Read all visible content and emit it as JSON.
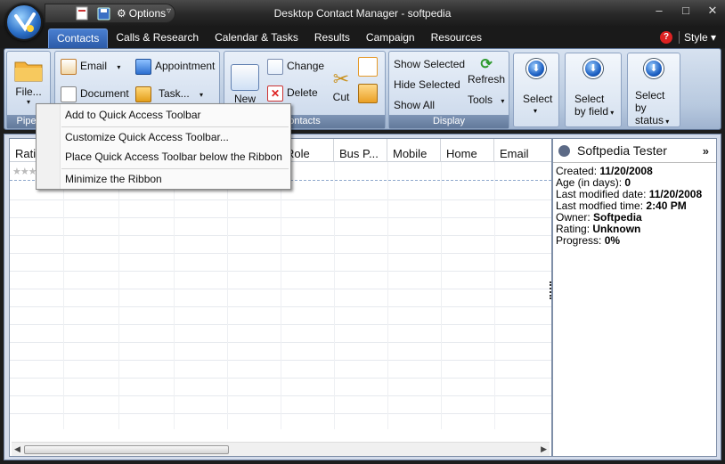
{
  "window": {
    "title": "Desktop Contact Manager - softpedia",
    "controls": {
      "minimize": "–",
      "maximize": "□",
      "close": "✕"
    }
  },
  "quick_access": {
    "options_label": "Options",
    "more_label": "▿"
  },
  "tabs": [
    {
      "label": "Contacts",
      "active": true
    },
    {
      "label": "Calls & Research"
    },
    {
      "label": "Calendar & Tasks"
    },
    {
      "label": "Results"
    },
    {
      "label": "Campaign"
    },
    {
      "label": "Resources"
    }
  ],
  "help_label": "?",
  "style_menu": "Style ▾",
  "ribbon": {
    "file_label": "File...",
    "pipeline_label": "Pipeli",
    "email_label": "Email",
    "appointment_label": "Appointment",
    "document_label": "Document",
    "task_label": "Task...",
    "new_label": "New",
    "change_label": "Change",
    "delete_label": "Delete",
    "cut_label": "Cut",
    "contacts_group": "ontacts",
    "show_selected": "Show Selected",
    "hide_selected": "Hide Selected",
    "show_all": "Show All",
    "refresh_label": "Refresh",
    "tools_label": "Tools",
    "display_group": "Display",
    "select_label": "Select",
    "select_by_field_1": "Select",
    "select_by_field_2": "by field",
    "select_by_status_1": "Select",
    "select_by_status_2": "by",
    "select_by_status_3": "status"
  },
  "context_menu": {
    "items": [
      {
        "label": "Add to Quick Access Toolbar"
      },
      {
        "label": "Customize Quick Access Toolbar..."
      },
      {
        "label": "Place Quick Access Toolbar below the Ribbon"
      },
      {
        "label": "Minimize the Ribbon"
      }
    ]
  },
  "grid": {
    "columns": [
      "Rati",
      "",
      "",
      "",
      "",
      "Role",
      "Bus P...",
      "Mobile",
      "Home",
      "Email"
    ],
    "first_row_rating": "★★★"
  },
  "detail": {
    "name": "Softpedia Tester",
    "expand": "»",
    "fields": [
      {
        "label": "Created:",
        "value": "11/20/2008"
      },
      {
        "label": "Age (in days):",
        "value": "0"
      },
      {
        "label": "Last modified date:",
        "value": "11/20/2008"
      },
      {
        "label": "Last modfied time:",
        "value": "2:40 PM"
      },
      {
        "label": "Owner:",
        "value": "Softpedia"
      },
      {
        "label": "Rating:",
        "value": "Unknown"
      },
      {
        "label": "Progress:",
        "value": "0%"
      }
    ]
  }
}
